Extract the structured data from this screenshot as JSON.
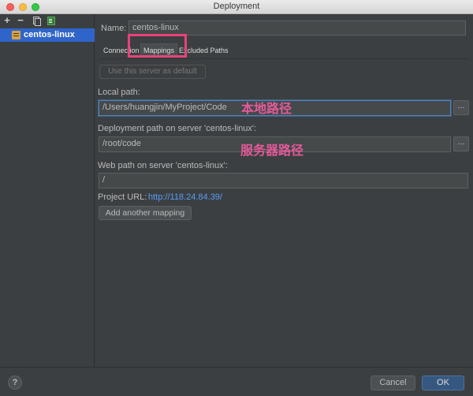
{
  "window": {
    "title": "Deployment"
  },
  "sidebar": {
    "tools": [
      "add-icon",
      "remove-icon",
      "copy-icon",
      "use-as-default-icon"
    ],
    "servers": [
      {
        "label": "centos-linux",
        "icon": "server-config-icon"
      }
    ]
  },
  "name_field": {
    "label": "Name:",
    "value": "centos-linux"
  },
  "tabs": [
    {
      "label": "Connection"
    },
    {
      "label": "Mappings",
      "active": true
    },
    {
      "label": "Excluded Paths"
    }
  ],
  "default_button": {
    "label": "Use this server as default"
  },
  "local_path": {
    "label": "Local path:",
    "value": "/Users/huangjin/MyProject/Code"
  },
  "deployment_path": {
    "label": "Deployment path on server 'centos-linux':",
    "value": "/root/code"
  },
  "web_path": {
    "label": "Web path on server 'centos-linux':",
    "value": "/"
  },
  "project_url": {
    "label": "Project URL:",
    "value": "http://118.24.84.39/"
  },
  "add_mapping_button": {
    "label": "Add another mapping"
  },
  "browse_label": "...",
  "annotations": {
    "local": "本地路径",
    "server": "服务器路径"
  },
  "footer": {
    "help": "?",
    "cancel": "Cancel",
    "ok": "OK"
  },
  "colors": {
    "accent": "#2f65ca",
    "highlight": "#e8437a",
    "link": "#589df6"
  }
}
